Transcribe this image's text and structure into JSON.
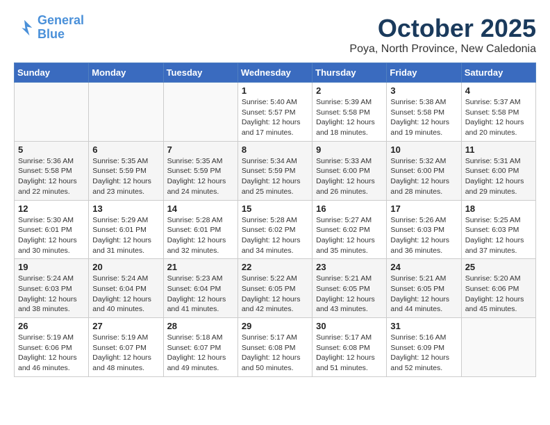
{
  "header": {
    "logo_line1": "General",
    "logo_line2": "Blue",
    "month": "October 2025",
    "location": "Poya, North Province, New Caledonia"
  },
  "weekdays": [
    "Sunday",
    "Monday",
    "Tuesday",
    "Wednesday",
    "Thursday",
    "Friday",
    "Saturday"
  ],
  "weeks": [
    [
      {
        "day": "",
        "info": ""
      },
      {
        "day": "",
        "info": ""
      },
      {
        "day": "",
        "info": ""
      },
      {
        "day": "1",
        "info": "Sunrise: 5:40 AM\nSunset: 5:57 PM\nDaylight: 12 hours\nand 17 minutes."
      },
      {
        "day": "2",
        "info": "Sunrise: 5:39 AM\nSunset: 5:58 PM\nDaylight: 12 hours\nand 18 minutes."
      },
      {
        "day": "3",
        "info": "Sunrise: 5:38 AM\nSunset: 5:58 PM\nDaylight: 12 hours\nand 19 minutes."
      },
      {
        "day": "4",
        "info": "Sunrise: 5:37 AM\nSunset: 5:58 PM\nDaylight: 12 hours\nand 20 minutes."
      }
    ],
    [
      {
        "day": "5",
        "info": "Sunrise: 5:36 AM\nSunset: 5:58 PM\nDaylight: 12 hours\nand 22 minutes."
      },
      {
        "day": "6",
        "info": "Sunrise: 5:35 AM\nSunset: 5:59 PM\nDaylight: 12 hours\nand 23 minutes."
      },
      {
        "day": "7",
        "info": "Sunrise: 5:35 AM\nSunset: 5:59 PM\nDaylight: 12 hours\nand 24 minutes."
      },
      {
        "day": "8",
        "info": "Sunrise: 5:34 AM\nSunset: 5:59 PM\nDaylight: 12 hours\nand 25 minutes."
      },
      {
        "day": "9",
        "info": "Sunrise: 5:33 AM\nSunset: 6:00 PM\nDaylight: 12 hours\nand 26 minutes."
      },
      {
        "day": "10",
        "info": "Sunrise: 5:32 AM\nSunset: 6:00 PM\nDaylight: 12 hours\nand 28 minutes."
      },
      {
        "day": "11",
        "info": "Sunrise: 5:31 AM\nSunset: 6:00 PM\nDaylight: 12 hours\nand 29 minutes."
      }
    ],
    [
      {
        "day": "12",
        "info": "Sunrise: 5:30 AM\nSunset: 6:01 PM\nDaylight: 12 hours\nand 30 minutes."
      },
      {
        "day": "13",
        "info": "Sunrise: 5:29 AM\nSunset: 6:01 PM\nDaylight: 12 hours\nand 31 minutes."
      },
      {
        "day": "14",
        "info": "Sunrise: 5:28 AM\nSunset: 6:01 PM\nDaylight: 12 hours\nand 32 minutes."
      },
      {
        "day": "15",
        "info": "Sunrise: 5:28 AM\nSunset: 6:02 PM\nDaylight: 12 hours\nand 34 minutes."
      },
      {
        "day": "16",
        "info": "Sunrise: 5:27 AM\nSunset: 6:02 PM\nDaylight: 12 hours\nand 35 minutes."
      },
      {
        "day": "17",
        "info": "Sunrise: 5:26 AM\nSunset: 6:03 PM\nDaylight: 12 hours\nand 36 minutes."
      },
      {
        "day": "18",
        "info": "Sunrise: 5:25 AM\nSunset: 6:03 PM\nDaylight: 12 hours\nand 37 minutes."
      }
    ],
    [
      {
        "day": "19",
        "info": "Sunrise: 5:24 AM\nSunset: 6:03 PM\nDaylight: 12 hours\nand 38 minutes."
      },
      {
        "day": "20",
        "info": "Sunrise: 5:24 AM\nSunset: 6:04 PM\nDaylight: 12 hours\nand 40 minutes."
      },
      {
        "day": "21",
        "info": "Sunrise: 5:23 AM\nSunset: 6:04 PM\nDaylight: 12 hours\nand 41 minutes."
      },
      {
        "day": "22",
        "info": "Sunrise: 5:22 AM\nSunset: 6:05 PM\nDaylight: 12 hours\nand 42 minutes."
      },
      {
        "day": "23",
        "info": "Sunrise: 5:21 AM\nSunset: 6:05 PM\nDaylight: 12 hours\nand 43 minutes."
      },
      {
        "day": "24",
        "info": "Sunrise: 5:21 AM\nSunset: 6:05 PM\nDaylight: 12 hours\nand 44 minutes."
      },
      {
        "day": "25",
        "info": "Sunrise: 5:20 AM\nSunset: 6:06 PM\nDaylight: 12 hours\nand 45 minutes."
      }
    ],
    [
      {
        "day": "26",
        "info": "Sunrise: 5:19 AM\nSunset: 6:06 PM\nDaylight: 12 hours\nand 46 minutes."
      },
      {
        "day": "27",
        "info": "Sunrise: 5:19 AM\nSunset: 6:07 PM\nDaylight: 12 hours\nand 48 minutes."
      },
      {
        "day": "28",
        "info": "Sunrise: 5:18 AM\nSunset: 6:07 PM\nDaylight: 12 hours\nand 49 minutes."
      },
      {
        "day": "29",
        "info": "Sunrise: 5:17 AM\nSunset: 6:08 PM\nDaylight: 12 hours\nand 50 minutes."
      },
      {
        "day": "30",
        "info": "Sunrise: 5:17 AM\nSunset: 6:08 PM\nDaylight: 12 hours\nand 51 minutes."
      },
      {
        "day": "31",
        "info": "Sunrise: 5:16 AM\nSunset: 6:09 PM\nDaylight: 12 hours\nand 52 minutes."
      },
      {
        "day": "",
        "info": ""
      }
    ]
  ]
}
